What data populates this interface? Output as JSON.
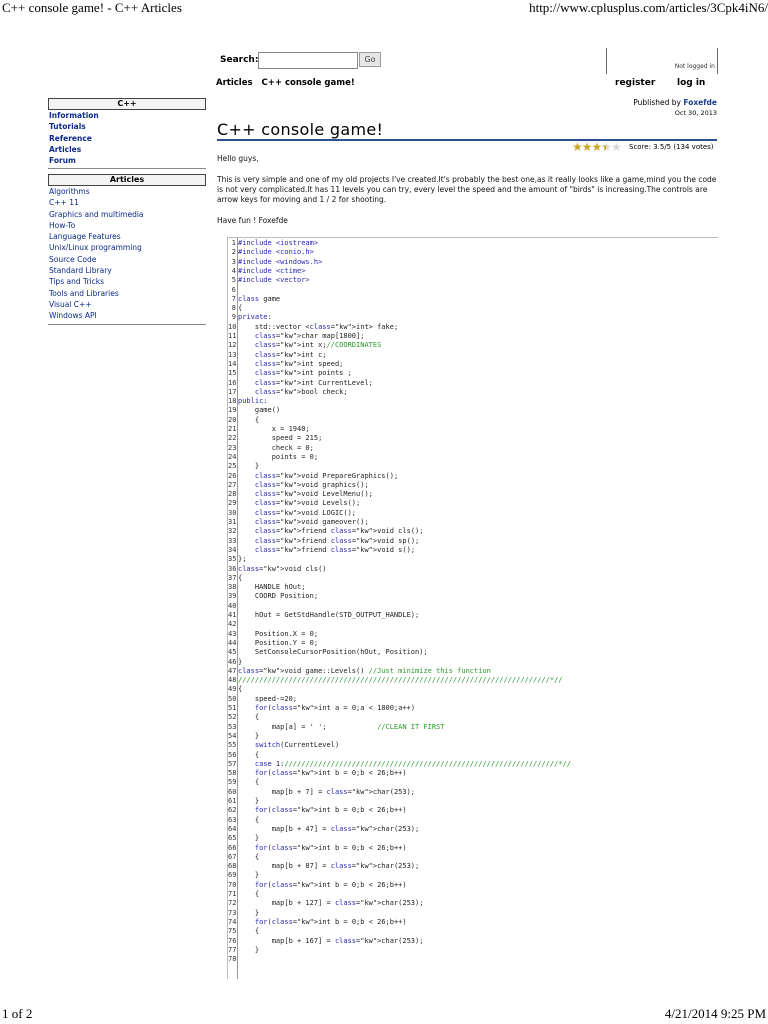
{
  "print_header": {
    "title": "C++ console game! - C++ Articles",
    "url": "http://www.cplusplus.com/articles/3Cpk4iN6/"
  },
  "print_footer": {
    "page": "1 of 2",
    "datetime": "4/21/2014 9:25 PM"
  },
  "search": {
    "label": "Search:",
    "value": "",
    "button": "Go"
  },
  "account": {
    "status": "Not logged in",
    "register": "register",
    "login": "log in"
  },
  "breadcrumb": [
    "Articles",
    "C++ console game!"
  ],
  "sidebar": {
    "cpp": {
      "title": "C++",
      "items": [
        "Information",
        "Tutorials",
        "Reference",
        "Articles",
        "Forum"
      ]
    },
    "articles": {
      "title": "Articles",
      "items": [
        "Algorithms",
        "C++ 11",
        "Graphics and multimedia",
        "How-To",
        "Language Features",
        "Unix/Linux programming",
        "Source Code",
        "Standard Library",
        "Tips and Tricks",
        "Tools and Libraries",
        "Visual C++",
        "Windows API"
      ]
    }
  },
  "article": {
    "published_by": "Published by",
    "author": "Foxefde",
    "date": "Oct 30, 2013",
    "title": "C++ console game!",
    "rating": 3.5,
    "score": "Score: 3.5/5 (134 votes)",
    "paragraphs": [
      "Hello guys,",
      "This is very simple and one of my old projects I've created.It's probably the best one,as it really looks like a game,mind you the code is not very complicated.It has 11 levels you can try, every level the speed and the amount of \"birds\" is increasing.The controls are arrow keys for moving and 1 / 2 for shooting.",
      "Have fun ! Foxefde"
    ],
    "code": [
      "#include <iostream>",
      "#include <conio.h>",
      "#include <windows.h>",
      "#include <ctime>",
      "#include <vector>",
      "",
      "class game",
      "{",
      "private:",
      "    std::vector <int> fake;",
      "    char map[1800];",
      "    int x;//COORDINATES",
      "    int c;",
      "    int speed;",
      "    int points ;",
      "    int CurrentLevel;",
      "    bool check;",
      "public:",
      "    game()",
      "    {",
      "        x = 1940;",
      "        speed = 215;",
      "        check = 0;",
      "        points = 0;",
      "    }",
      "    void PrepareGraphics();",
      "    void graphics();",
      "    void LevelMenu();",
      "    void Levels();",
      "    void LOGIC();",
      "    void gameover();",
      "    friend void cls();",
      "    friend void sp();",
      "    friend void s();",
      "};",
      "void cls()",
      "{",
      "    HANDLE hOut;",
      "    COORD Position;",
      "",
      "    hOut = GetStdHandle(STD_OUTPUT_HANDLE);",
      "",
      "    Position.X = 0;",
      "    Position.Y = 0;",
      "    SetConsoleCursorPosition(hOut, Position);",
      "}",
      "void game::Levels() //Just minimize this function",
      "//////////////////////////////////////////////////////////////////////////*//",
      "{",
      "    speed-=20;",
      "    for(int a = 0;a < 1800;a++)",
      "    {",
      "        map[a] = ' ';            //CLEAN IT FIRST",
      "    }",
      "    switch(CurrentLevel)",
      "    {",
      "    case 1://///////////////////////////////////////////////////////////////*//",
      "    for(int b = 0;b < 26;b++)",
      "    {",
      "        map[b + 7] = char(253);",
      "    }",
      "    for(int b = 0;b < 26;b++)",
      "    {",
      "        map[b + 47] = char(253);",
      "    }",
      "    for(int b = 0;b < 26;b++)",
      "    {",
      "        map[b + 87] = char(253);",
      "    }",
      "    for(int b = 0;b < 26;b++)",
      "    {",
      "        map[b + 127] = char(253);",
      "    }",
      "    for(int b = 0;b < 26;b++)",
      "    {",
      "        map[b + 167] = char(253);",
      "    }",
      ""
    ]
  }
}
